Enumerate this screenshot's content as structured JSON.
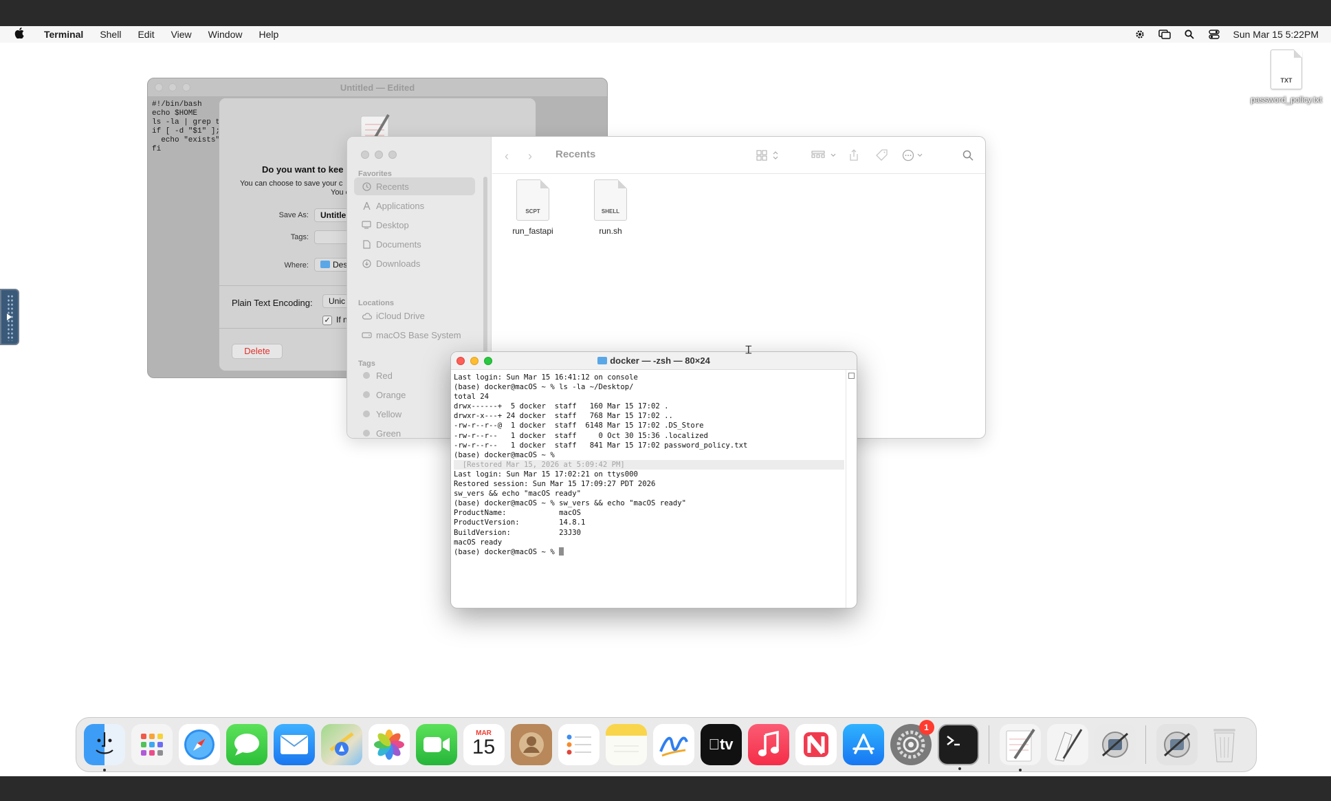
{
  "menubar": {
    "app_name": "Terminal",
    "items": [
      "Shell",
      "Edit",
      "View",
      "Window",
      "Help"
    ],
    "clock": "Sun Mar 15  5:22PM"
  },
  "desktop": {
    "file_name": "password_policy.txt",
    "file_type": "TXT"
  },
  "textedit": {
    "title": "Untitled — Edited",
    "content": "#!/bin/bash\necho $HOME\nls -la | grep t\nif [ -d \"$1\" ];\n  echo \"exists\"\nfi"
  },
  "save_dialog": {
    "heading": "Do you want to kee",
    "subtext": "You can choose to save your c",
    "subtext2": "You c",
    "save_as_label": "Save As:",
    "save_as_value": "Untitle",
    "tags_label": "Tags:",
    "where_label": "Where:",
    "where_value": "Des",
    "encoding_label": "Plain Text Encoding:",
    "encoding_value": "Unic",
    "checkbox_label": "If n",
    "delete_label": "Delete"
  },
  "finder": {
    "title": "Recents",
    "favorites_header": "Favorites",
    "favorites": [
      "Recents",
      "Applications",
      "Desktop",
      "Documents",
      "Downloads"
    ],
    "locations_header": "Locations",
    "locations": [
      "iCloud Drive",
      "macOS Base System"
    ],
    "tags_header": "Tags",
    "tags": [
      "Red",
      "Orange",
      "Yellow",
      "Green"
    ],
    "files": [
      {
        "name": "run_fastapi",
        "type": "SCPT"
      },
      {
        "name": "run.sh",
        "type": "SHELL"
      }
    ]
  },
  "terminal": {
    "title": "docker — -zsh — 80×24",
    "lines": [
      "Last login: Sun Mar 15 16:41:12 on console",
      "(base) docker@macOS ~ % ls -la ~/Desktop/",
      "total 24",
      "drwx------+  5 docker  staff   160 Mar 15 17:02 .",
      "drwxr-x---+ 24 docker  staff   768 Mar 15 17:02 ..",
      "-rw-r--r--@  1 docker  staff  6148 Mar 15 17:02 .DS_Store",
      "-rw-r--r--   1 docker  staff     0 Oct 30 15:36 .localized",
      "-rw-r--r--   1 docker  staff   841 Mar 15 17:02 password_policy.txt",
      "(base) docker@macOS ~ %",
      "  [Restored Mar 15, 2026 at 5:09:42 PM]",
      "Last login: Sun Mar 15 17:02:21 on ttys000",
      "Restored session: Sun Mar 15 17:09:27 PDT 2026",
      "sw_vers && echo \"macOS ready\"",
      "(base) docker@macOS ~ % sw_vers && echo \"macOS ready\"",
      "ProductName:\t\tmacOS",
      "ProductVersion:\t\t14.8.1",
      "BuildVersion:\t\t23J30",
      "macOS ready"
    ],
    "prompt": "(base) docker@macOS ~ % "
  },
  "dock": {
    "calendar_month": "MAR",
    "calendar_day": "15",
    "settings_badge": "1"
  }
}
